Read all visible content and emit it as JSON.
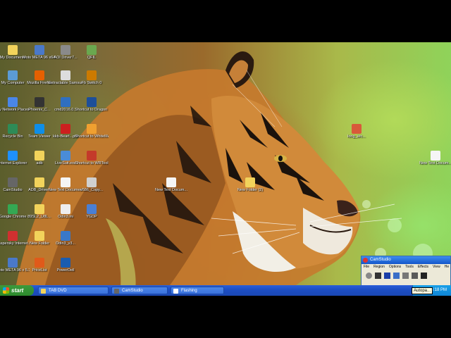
{
  "desktop": {
    "icons": [
      {
        "label": "My Documents",
        "icon": "folder-docs-icon",
        "color": "#f2d35b"
      },
      {
        "label": "Moto META 96 x64 5.3308.4...",
        "icon": "app-icon",
        "color": "#4a79c9"
      },
      {
        "label": "AOI Driver7...",
        "icon": "driver-icon",
        "color": "#8a8a8a"
      },
      {
        "label": "QFIL",
        "icon": "qfil-icon",
        "color": "#6aa84f"
      },
      {
        "label": "My Computer",
        "icon": "computer-icon",
        "color": "#5b9bd5"
      },
      {
        "label": "Mozilla Firefox",
        "icon": "firefox-icon",
        "color": "#e66000"
      },
      {
        "label": "Extractable Samsung...",
        "icon": "exe-icon",
        "color": "#dddddd"
      },
      {
        "label": "Fb Switch 0",
        "icon": "tool-icon",
        "color": "#cc7a00"
      },
      {
        "label": "My Network Places",
        "icon": "network-icon",
        "color": "#4a86e8"
      },
      {
        "label": "Phoenix_C...",
        "icon": "phoenix-icon",
        "color": "#333333"
      },
      {
        "label": "cmd2016.0...",
        "icon": "settings-icon",
        "color": "#2f6fc0"
      },
      {
        "label": "Shortcut to Dragon Flash...",
        "icon": "dragon-icon",
        "color": "#1d4f99"
      },
      {
        "label": "Recycle Bin",
        "icon": "recycle-bin-icon",
        "color": "#2e8b57"
      },
      {
        "label": "Team Viewer",
        "icon": "teamviewer-icon",
        "color": "#0e8ee9"
      },
      {
        "label": "kkb-Beart...pdf",
        "icon": "pdf-icon",
        "color": "#cc1f1f"
      },
      {
        "label": "Shortcut to WhiteMAD...",
        "icon": "shortcut-icon",
        "color": "#f0a030"
      },
      {
        "label": "Internet Explorer",
        "icon": "ie-icon",
        "color": "#1e90ff"
      },
      {
        "label": "adb",
        "icon": "folder-icon",
        "color": "#f2d35b"
      },
      {
        "label": "LiveSuit.exe",
        "icon": "livesuit-icon",
        "color": "#4a8cd8"
      },
      {
        "label": "Shortcut to WRTool",
        "icon": "wrtool-icon",
        "color": "#c43a2a"
      },
      {
        "label": "CamStudio",
        "icon": "camstudio-icon",
        "color": "#666666"
      },
      {
        "label": "ADB_Drivers",
        "icon": "folder-icon",
        "color": "#f2d35b"
      },
      {
        "label": "New Text Document.txt",
        "icon": "text-file-icon",
        "color": "#f5f5f5"
      },
      {
        "label": "v586_Copy...",
        "icon": "file-icon",
        "color": "#d0d0d0"
      },
      {
        "label": "Google Chrome",
        "icon": "chrome-icon",
        "color": "#34a853"
      },
      {
        "label": "89SL2_U8L...",
        "icon": "folder-icon",
        "color": "#f2d35b"
      },
      {
        "label": "Odin3.ini",
        "icon": "ini-file-icon",
        "color": "#eeeeee"
      },
      {
        "label": "YGDP",
        "icon": "ygdp-icon",
        "color": "#4a7fd4"
      },
      {
        "label": "Kaspersky Internet...",
        "icon": "kaspersky-icon",
        "color": "#d03030"
      },
      {
        "label": "New Folder",
        "icon": "folder-icon",
        "color": "#f2d35b"
      },
      {
        "label": "Odin3_v3...",
        "icon": "odin-icon",
        "color": "#3a78c8"
      },
      {
        "label": "Moto META 96 x 5.3308.0...",
        "icon": "app-icon",
        "color": "#4a79c9"
      },
      {
        "label": "PriceList",
        "icon": "pricelist-icon",
        "color": "#e05a1a"
      },
      {
        "label": "PowerDell",
        "icon": "powerdell-icon",
        "color": "#1a5cb0"
      },
      {
        "label": "New Text Docum...",
        "icon": "text-file-icon",
        "color": "#f5f5f5"
      },
      {
        "label": "New Folder (2)",
        "icon": "folder-icon",
        "color": "#f2d35b"
      },
      {
        "label": "long_arc...",
        "icon": "archive-icon",
        "color": "#d85a3a"
      },
      {
        "label": "New Text Docum...",
        "icon": "text-file-icon",
        "color": "#f5f5f5"
      }
    ]
  },
  "camstudio": {
    "title": "CamStudio",
    "menu": [
      "File",
      "Region",
      "Options",
      "Tools",
      "Effects",
      "View",
      "He"
    ],
    "tools": [
      {
        "icon": "record-icon",
        "color": "#888888"
      },
      {
        "icon": "pause-icon",
        "color": "#333333"
      },
      {
        "icon": "stop-icon",
        "color": "#1a3ea8"
      },
      {
        "icon": "annotate-icon",
        "color": "#3a6fc8"
      },
      {
        "icon": "copy-icon",
        "color": "#777777"
      },
      {
        "icon": "web-icon",
        "color": "#5a5a5a"
      },
      {
        "icon": "minimize-view-icon",
        "color": "#222222"
      }
    ]
  },
  "taskbar": {
    "start_label": "start",
    "tasks": [
      {
        "label": "TAB DVD",
        "icon": "folder-icon",
        "color": "#f2d35b",
        "active": false
      },
      {
        "label": "CamStudio",
        "icon": "camstudio-icon",
        "color": "#666666",
        "active": true
      },
      {
        "label": "Flashing",
        "icon": "notepad-icon",
        "color": "#ffffff",
        "active": false
      }
    ],
    "clock": "4:18 PM"
  },
  "tooltip": "Autopa..."
}
